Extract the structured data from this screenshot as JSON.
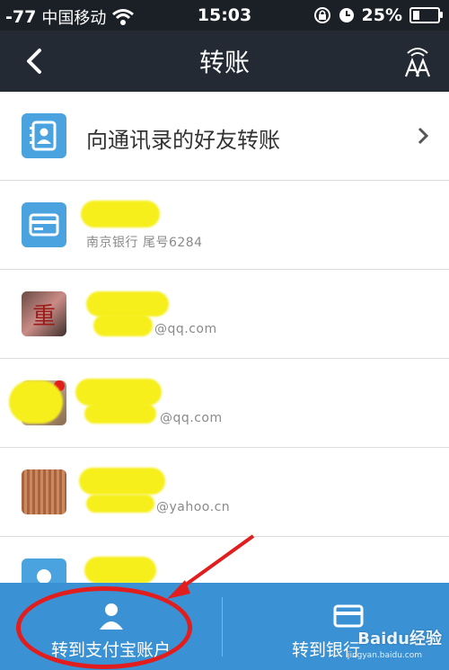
{
  "status_bar": {
    "signal": "-77",
    "carrier": "中国移动",
    "time": "15:03",
    "battery": "25%",
    "battery_level": 0.25
  },
  "nav": {
    "title": "转账"
  },
  "contacts_entry": {
    "label": "向通讯录的好友转账"
  },
  "recent": [
    {
      "name": "",
      "sub": "南京银行   尾号6284",
      "icon": "bank-card-icon"
    },
    {
      "name": "",
      "sub": "@qq.com",
      "icon": "photo-avatar"
    },
    {
      "name": "",
      "sub": "@qq.com",
      "icon": "photo-avatar"
    },
    {
      "name": "",
      "sub": "@yahoo.cn",
      "icon": "photo-avatar"
    },
    {
      "name": "",
      "sub": "",
      "icon": "person-avatar"
    }
  ],
  "bottom_tabs": [
    {
      "label": "转到支付宝账户",
      "icon": "person-icon"
    },
    {
      "label": "转到银行",
      "icon": "card-icon"
    }
  ],
  "watermark": {
    "text": "Baidu经验",
    "sub": "jingyan.baidu.com"
  },
  "colors": {
    "accent": "#3a92d4",
    "annotation": "#e11d1d",
    "redaction": "#f6ef1b"
  }
}
